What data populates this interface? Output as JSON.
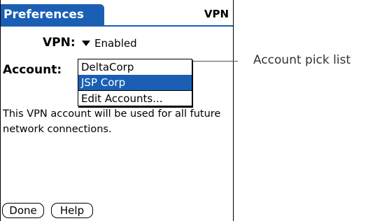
{
  "titlebar": {
    "app_title": "Preferences",
    "panel_name": "VPN"
  },
  "vpn": {
    "label": "VPN:",
    "value": "Enabled"
  },
  "account": {
    "label": "Account:",
    "options": [
      "DeltaCorp",
      "JSP Corp",
      "Edit Accounts..."
    ],
    "selected": "JSP Corp"
  },
  "description": "This VPN account will be used for all future network connections.",
  "buttons": {
    "done": "Done",
    "help": "Help"
  },
  "callout": {
    "text": "Account pick list"
  },
  "colors": {
    "accent": "#1a5fb4"
  }
}
